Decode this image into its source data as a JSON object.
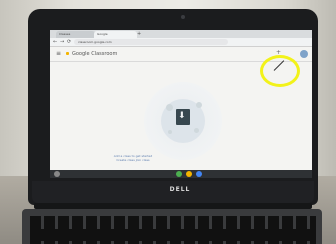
{
  "browser": {
    "tabs": [
      {
        "label": "Classes"
      },
      {
        "label": "Google"
      }
    ],
    "new_tab_glyph": "+",
    "nav_glyphs": [
      "←",
      "→",
      "⟳"
    ],
    "url": "classroom.google.com"
  },
  "app": {
    "menu_glyph": "≡",
    "title": "Google Classroom",
    "add_glyph": "+"
  },
  "empty_state": {
    "line1": "Add a class to get started",
    "line2": "Create class    Join class"
  },
  "laptop": {
    "brand": "DELL"
  },
  "colors": {
    "highlight": "#f2f21a",
    "bezel": "#1b1c1e",
    "screen": "#f4f4f2",
    "shelf": "#2e3134"
  }
}
